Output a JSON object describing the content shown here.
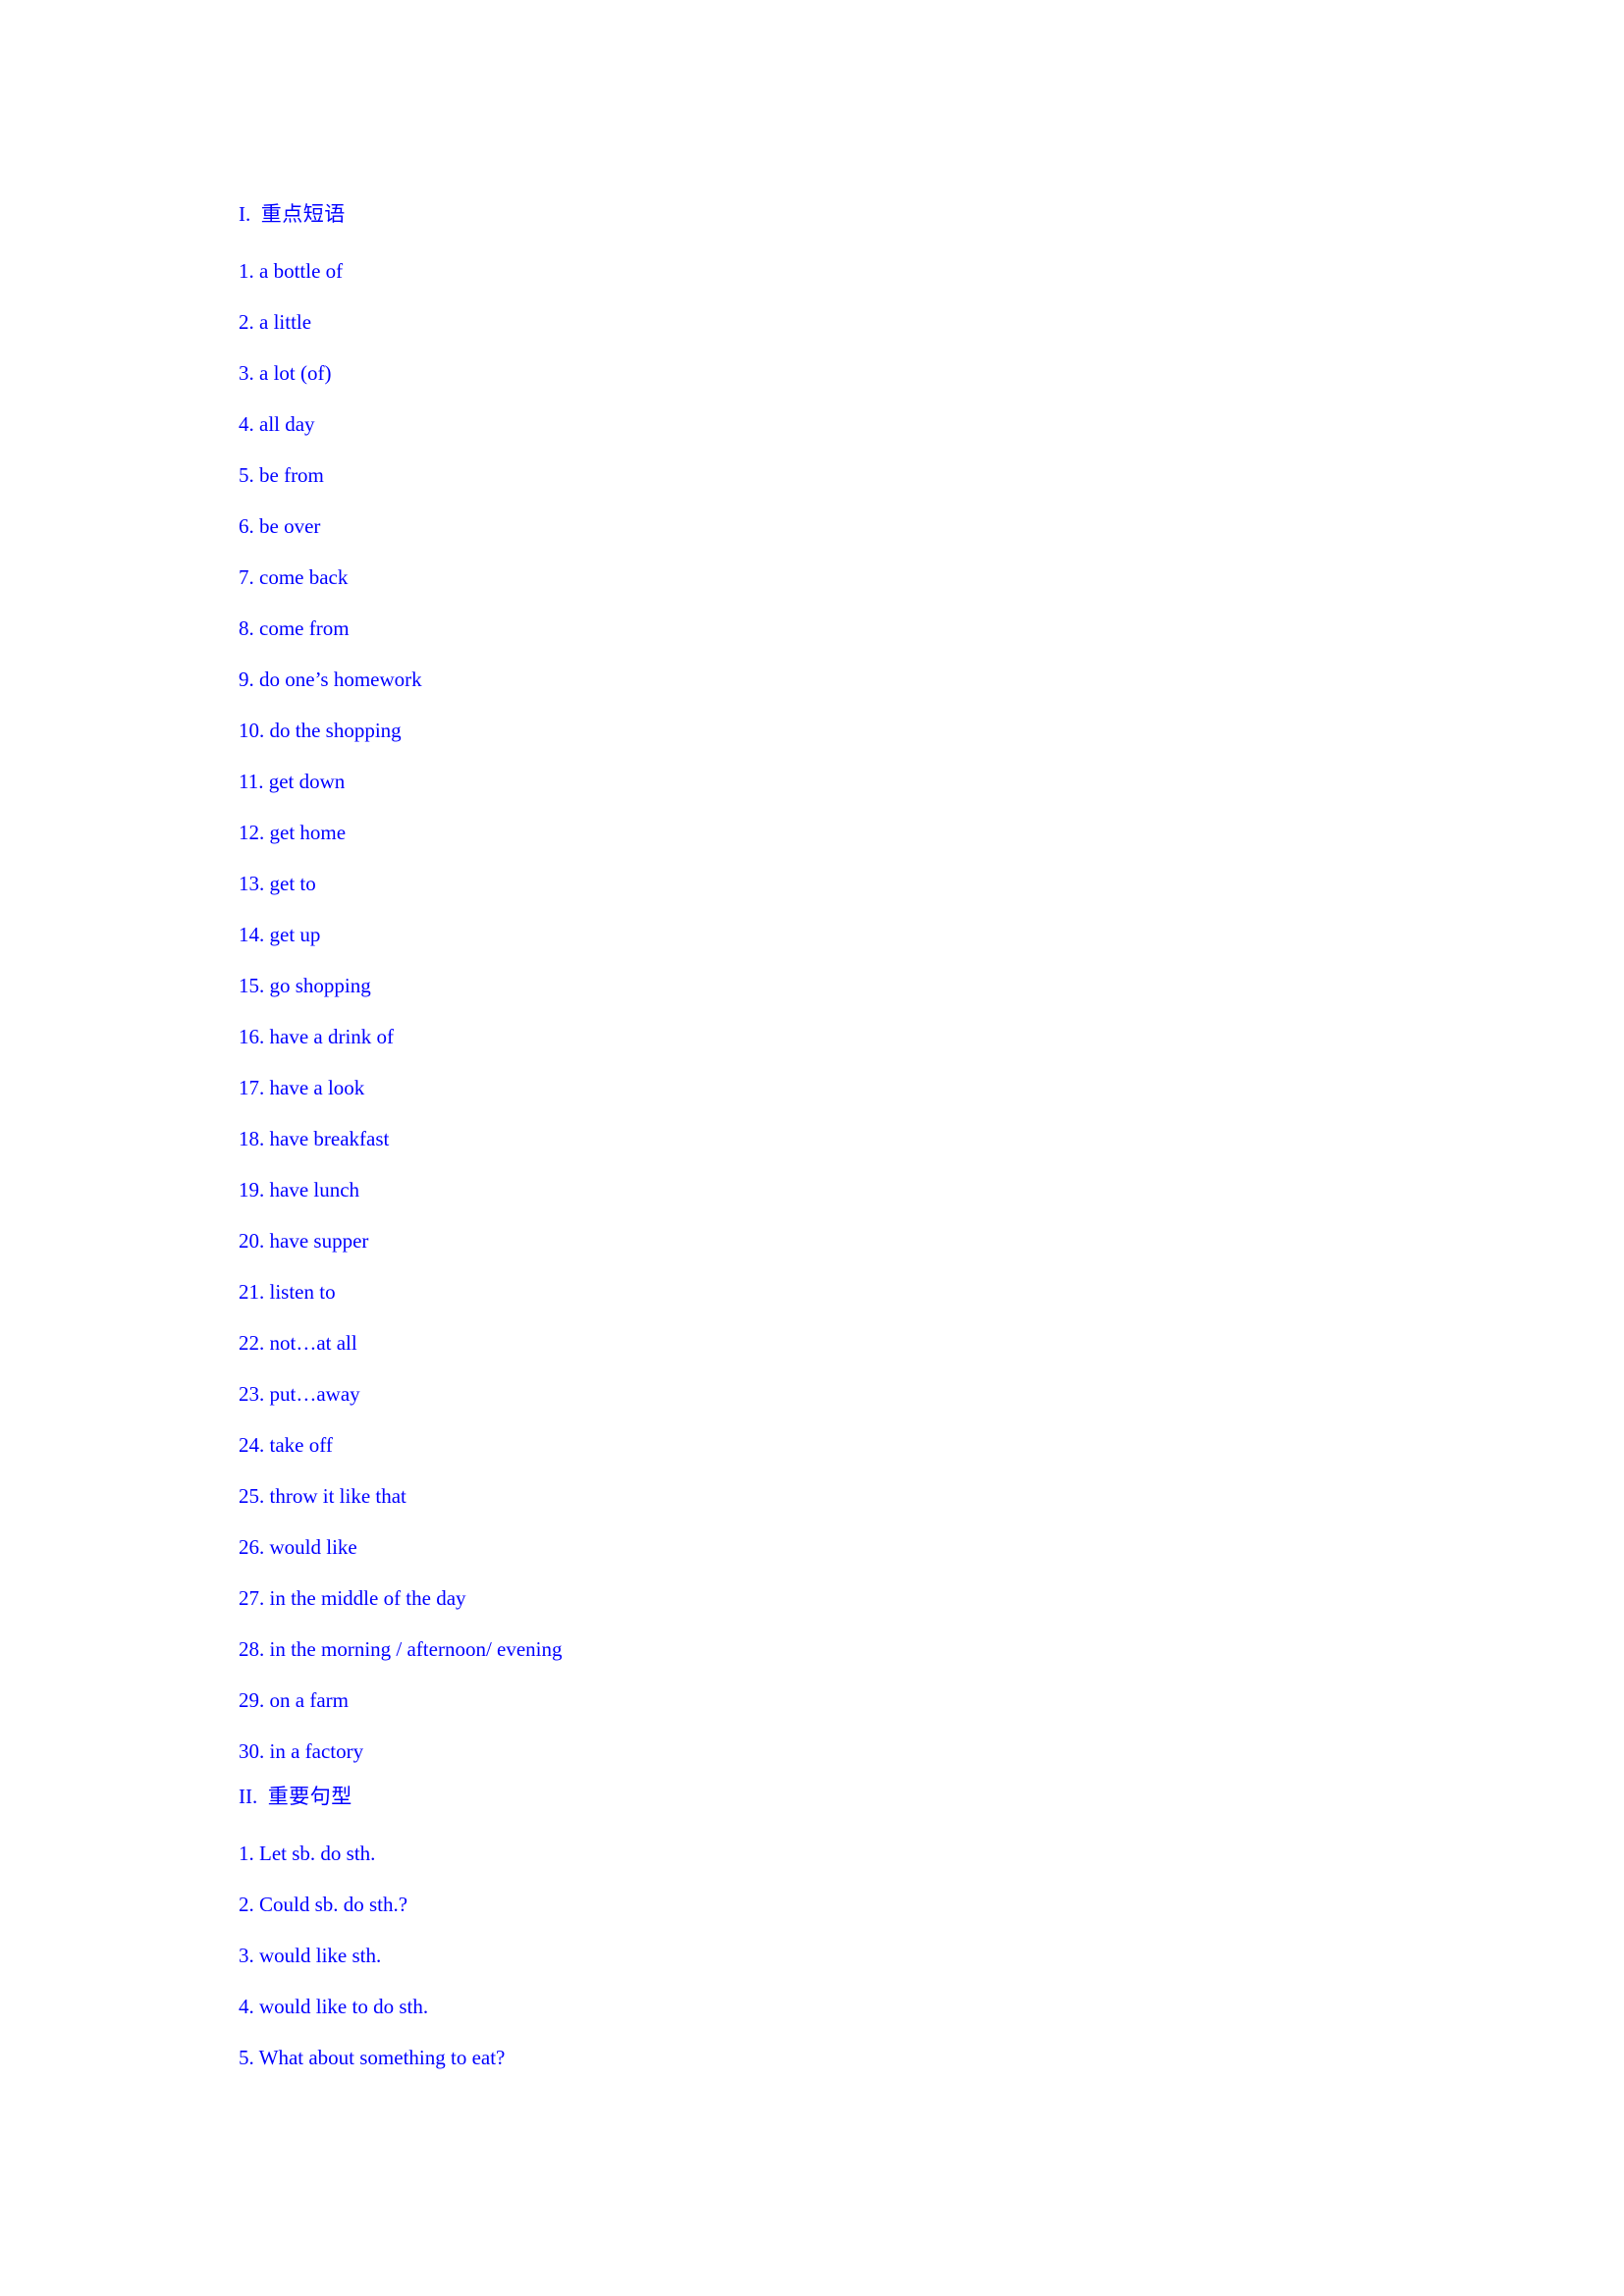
{
  "document": {
    "text_color": "#0000ff",
    "background_color": "#ffffff",
    "sections": [
      {
        "numeral": "I.",
        "title": "重点短语",
        "items": [
          "1. a bottle of",
          "2. a little",
          "3. a lot (of)",
          "4. all day",
          "5. be from",
          "6. be over",
          "7. come back",
          "8. come from",
          "9. do one’s homework",
          "10. do the shopping",
          "11. get down",
          "12. get home",
          "13. get to",
          "14. get up",
          "15. go shopping",
          "16. have a drink of",
          "17. have a look",
          "18. have breakfast",
          "19. have lunch",
          "20. have supper",
          "21. listen to",
          "22. not…at all",
          "23. put…away",
          "24. take off",
          "25. throw it like that",
          "26. would like",
          "27. in the middle of the day",
          "28. in the morning / afternoon/ evening",
          "29. on a farm",
          "30. in a factory"
        ]
      },
      {
        "numeral": "II.",
        "title": "重要句型",
        "items": [
          "1. Let sb. do sth.",
          "2. Could sb. do sth.?",
          "3. would like sth.",
          "4. would like to do sth.",
          "5. What about something to eat?"
        ]
      }
    ]
  }
}
